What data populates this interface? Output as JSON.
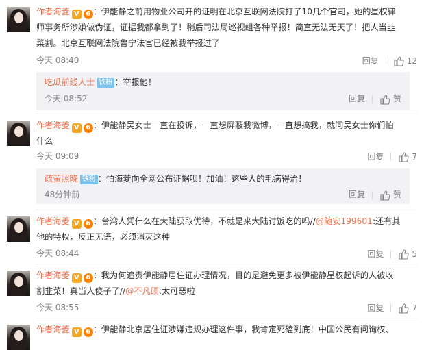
{
  "comments": [
    {
      "user": "作者海菱",
      "vip_badge": "V",
      "level_badge": "6",
      "text_line1": "：伊能静之前用物业公司开的证明在北京互联网法院打了10几个官司，她的星权律",
      "text_line2": "师事务所涉嫌做伪证，证据我都拿到了！稍后司法局巡视组各种举报！简直无法无天了！把人当韭",
      "text_line3": "菜割。北京互联网法院鲁宁法官已经被我举报过了",
      "time": "今天 08:40",
      "reply_label": "回复",
      "likes": "12",
      "reply": {
        "user": "吃瓜前线人士",
        "fan_badge": "铁粉",
        "text": "：举报他！",
        "time": "今天 08:52",
        "reply_label": "回复",
        "like_label": "赞"
      }
    },
    {
      "user": "作者海菱",
      "vip_badge": "V",
      "level_badge": "6",
      "text_line1": "：伊能静吴女士一直在投诉，一直想屏蔽我微博，一直想搞我，就问吴女士你们怕",
      "text_line2": "什么",
      "time": "今天 09:09",
      "reply_label": "回复",
      "likes": "7",
      "reply": {
        "user": "疏萤照晓",
        "fan_badge": "铁粉",
        "text": "：怕海菱向全网公布证据呗！加油！这些人的毛病得治！",
        "time": "48分钟前",
        "reply_label": "回复",
        "like_label": "赞"
      }
    },
    {
      "user": "作者海菱",
      "vip_badge": "V",
      "level_badge": "6",
      "text_line1": "：台湾人凭什么在大陆获取优待，不就是来大陆讨饭吃的吗//",
      "mention": "@随安199601",
      "text_line1b": ":还有其",
      "text_line2": "他的特权，反正无语，必须消灭这种",
      "time": "今天 08:44",
      "reply_label": "回复",
      "likes": "5"
    },
    {
      "user": "作者海菱",
      "vip_badge": "V",
      "level_badge": "6",
      "text_line1": "：我为何追责伊能静居住证办理情况，目的是避免更多被伊能静星权起诉的人被收",
      "text_line2": "割韭菜！真当人傻子了//",
      "mention": "@不凡硕",
      "text_line2b": ":太可恶啦",
      "time": "今天 08:55",
      "reply_label": "回复",
      "likes": "7"
    },
    {
      "user": "作者海菱",
      "vip_badge": "V",
      "level_badge": "6",
      "text_line1": "：伊能静北京居住证涉嫌违规办理这件事，我肯定死磕到底！中国公民有问询权、"
    }
  ],
  "colors": {
    "username": "#eb7350",
    "meta": "#808080",
    "reply_bg": "#f2f2f5",
    "fan_badge": "#7cc1e9"
  },
  "icons": {
    "like": "thumb-up-icon",
    "vip": "vip-v-icon",
    "level": "level-badge-icon"
  }
}
